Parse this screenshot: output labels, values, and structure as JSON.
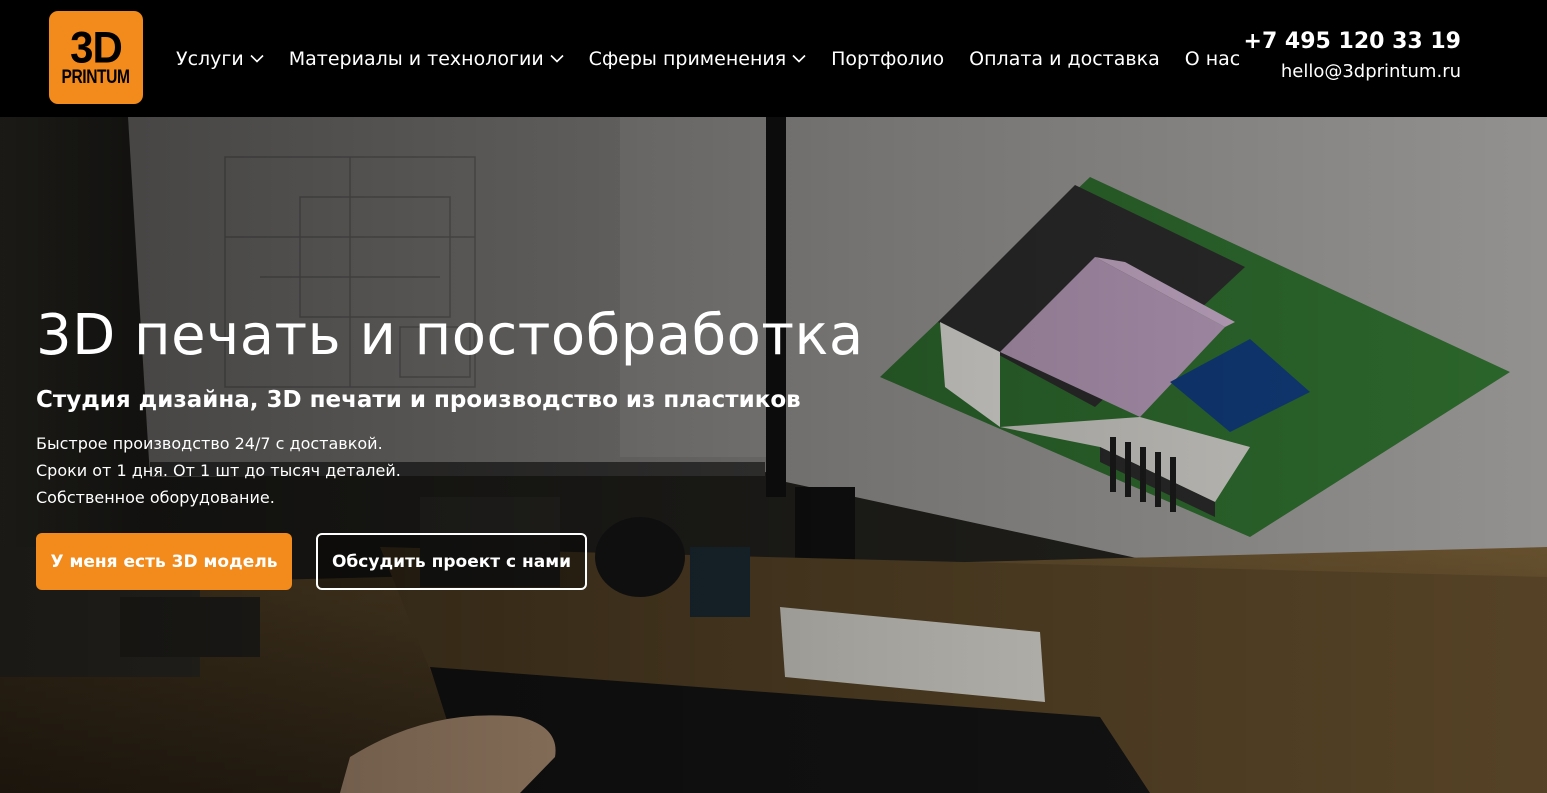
{
  "logo": {
    "line1": "3D",
    "line2": "PRINTUM"
  },
  "nav": {
    "items": [
      {
        "label": "Услуги",
        "has_dropdown": true
      },
      {
        "label": "Материалы и технологии",
        "has_dropdown": true
      },
      {
        "label": "Сферы применения",
        "has_dropdown": true
      },
      {
        "label": "Портфолио",
        "has_dropdown": false
      },
      {
        "label": "Оплата и доставка",
        "has_dropdown": false
      },
      {
        "label": "О нас",
        "has_dropdown": false
      }
    ]
  },
  "contacts": {
    "phone": "+7 495 120 33 19",
    "email": "hello@3dprintum.ru"
  },
  "hero": {
    "title": "3D печать и постобработка",
    "subtitle": "Студия дизайна, 3D печати и производство из пластиков",
    "lines": [
      "Быстрое производство 24/7 с доставкой.",
      "Сроки от 1 дня. От 1 шт до тысяч деталей.",
      "Собственное оборудование."
    ],
    "primary_button": "У меня есть 3D модель",
    "secondary_button": "Обсудить проект с нами"
  },
  "colors": {
    "accent": "#f28a1c",
    "header_bg": "#000000",
    "text": "#ffffff"
  }
}
